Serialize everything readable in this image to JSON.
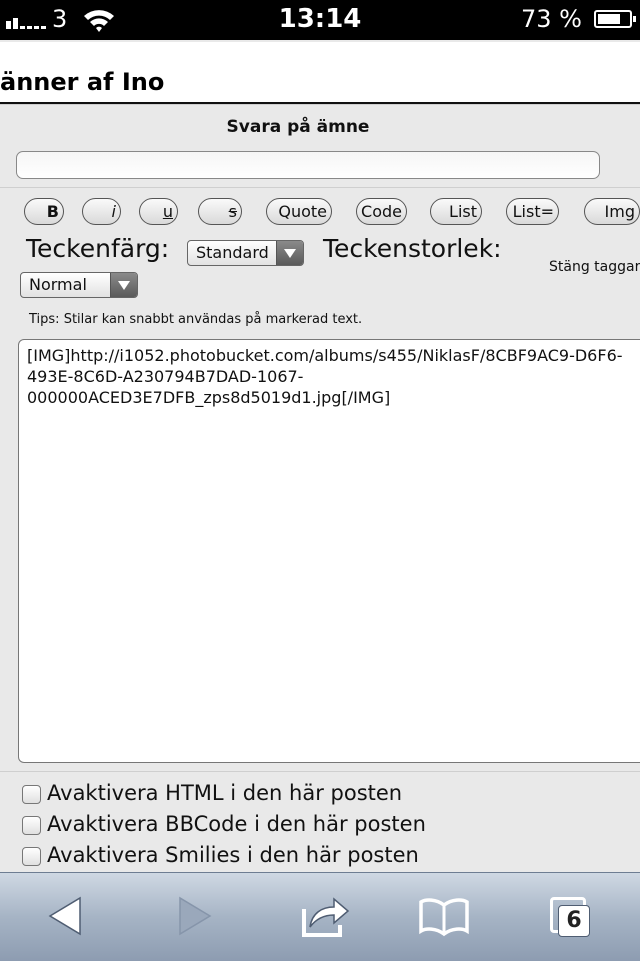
{
  "status_bar": {
    "carrier": "3",
    "time": "13:14",
    "battery_percent": "73 %",
    "battery_level": 0.73,
    "icons": [
      "signal-icon",
      "wifi-icon",
      "battery-icon"
    ]
  },
  "page": {
    "title": "änner af Ino"
  },
  "form": {
    "section_title": "Svara på ämne",
    "subject_value": "",
    "buttons": {
      "bold": "B",
      "italic": "i",
      "underline": "u",
      "strike": "s",
      "quote": "Quote",
      "code": "Code",
      "list": "List",
      "list_ordered": "List=",
      "img": "Img"
    },
    "font_color_label": "Teckenfärg:",
    "font_color_value": "Standard",
    "font_size_label": "Teckenstorlek:",
    "font_size_value": "Normal",
    "close_tags_label": "Stäng taggar",
    "tips": "Tips: Stilar kan snabbt användas på markerad text.",
    "message_lines": [
      "[IMG]http://i1052.photobucket.com/albums/s455/NiklasF/8CBF9AC9-D6F6-",
      "493E-8C6D-A230794B7DAD-1067-",
      "000000ACED3E7DFB_zps8d5019d1.jpg[/IMG]"
    ],
    "checkboxes": [
      "Avaktivera HTML i den här posten",
      "Avaktivera BBCode i den här posten",
      "Avaktivera Smilies i den här posten"
    ]
  },
  "toolbar": {
    "tabs_count": "6",
    "icons": [
      "back-icon",
      "forward-icon",
      "share-icon",
      "bookmarks-icon",
      "tabs-icon"
    ],
    "colors": {
      "bar": "#a6b4c5",
      "icon": "#ffffff"
    }
  }
}
